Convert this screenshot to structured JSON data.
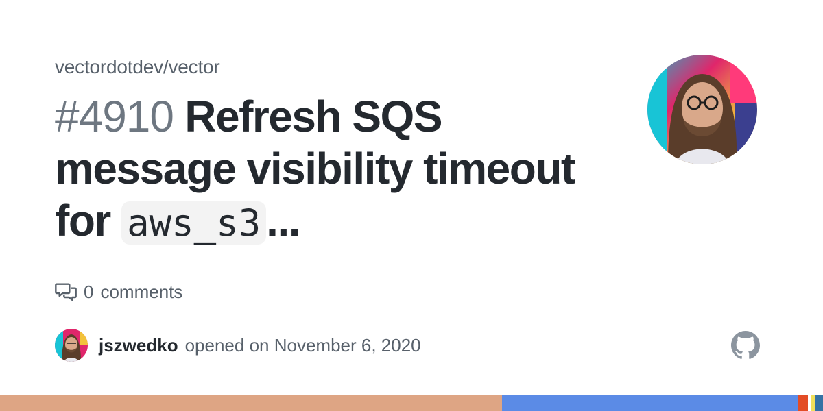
{
  "repo": {
    "name": "vectordotdev/vector"
  },
  "issue": {
    "number": "#4910",
    "title": "Refresh SQS message visibility timeout for",
    "title_code": "aws_s3",
    "title_ellipsis": "..."
  },
  "comments": {
    "count": "0",
    "label": "comments",
    "icon": "comment-discussion-icon"
  },
  "author": {
    "username": "jszwedko",
    "opened_text": "opened on November 6, 2020"
  },
  "icons": {
    "github": "github-mark-icon"
  },
  "language_bar": [
    {
      "color": "#dea584",
      "fraction": 0.61
    },
    {
      "color": "#5b8be6",
      "fraction": 0.36
    },
    {
      "color": "#e34c26",
      "fraction": 0.012
    },
    {
      "color": "#ffffff",
      "fraction": 0.004
    },
    {
      "color": "#f1e05a",
      "fraction": 0.004
    },
    {
      "color": "#3572a5",
      "fraction": 0.01
    }
  ]
}
